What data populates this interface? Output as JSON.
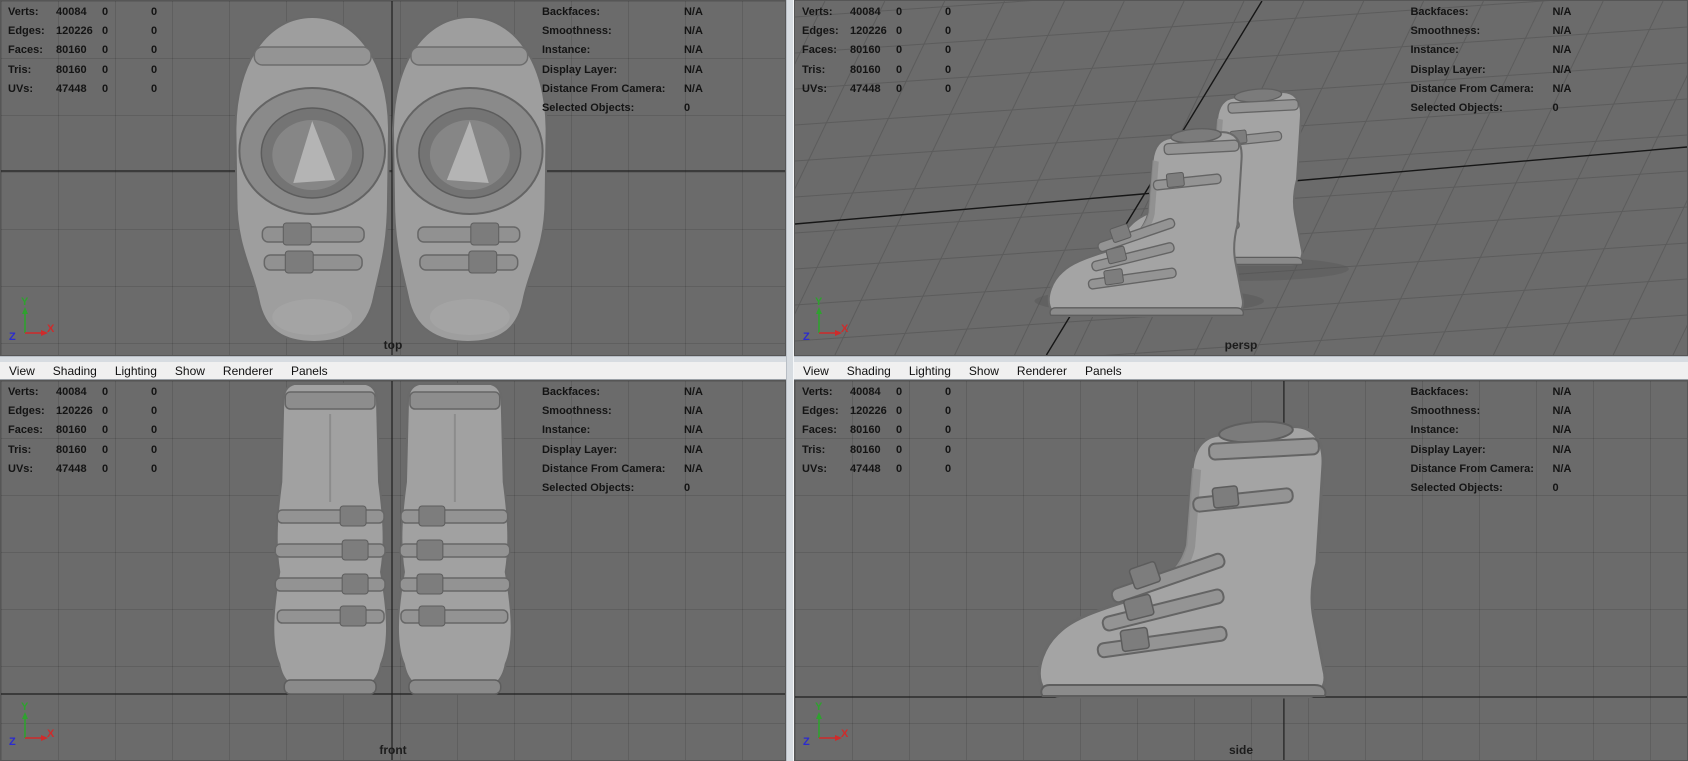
{
  "menu": {
    "items": [
      "View",
      "Shading",
      "Lighting",
      "Show",
      "Renderer",
      "Panels"
    ]
  },
  "hud": {
    "left_rows": [
      {
        "label": "Verts:",
        "c1": "40084",
        "c2": "0",
        "c3": "0"
      },
      {
        "label": "Edges:",
        "c1": "120226",
        "c2": "0",
        "c3": "0"
      },
      {
        "label": "Faces:",
        "c1": "80160",
        "c2": "0",
        "c3": "0"
      },
      {
        "label": "Tris:",
        "c1": "80160",
        "c2": "0",
        "c3": "0"
      },
      {
        "label": "UVs:",
        "c1": "47448",
        "c2": "0",
        "c3": "0"
      }
    ],
    "right_rows": [
      {
        "label": "Backfaces:",
        "value": "N/A"
      },
      {
        "label": "Smoothness:",
        "value": "N/A"
      },
      {
        "label": "Instance:",
        "value": "N/A"
      },
      {
        "label": "Display Layer:",
        "value": "N/A"
      },
      {
        "label": "Distance From Camera:",
        "value": "N/A"
      },
      {
        "label": "Selected Objects:",
        "value": "0"
      }
    ]
  },
  "viewports": {
    "top": {
      "label": "top"
    },
    "persp": {
      "label": "persp"
    },
    "front": {
      "label": "front"
    },
    "side": {
      "label": "side"
    }
  },
  "axis": {
    "x": "X",
    "y": "Y",
    "z": "Z"
  },
  "colors": {
    "viewport_bg": "#6b6b6b",
    "grid_line": "#5c5c5c",
    "axis_line": "#1f1f1f",
    "menu_bg": "#f0f0f0",
    "hud_text": "#141414",
    "model_gray": "#a3a3a3",
    "axis_x_color": "#cf2b2b",
    "axis_y_color": "#2fa12f",
    "axis_z_color": "#2b2bd0"
  }
}
